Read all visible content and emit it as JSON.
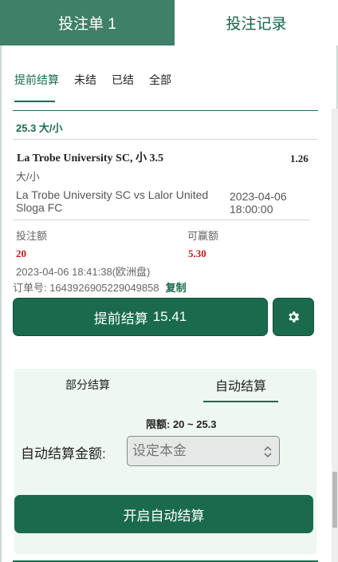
{
  "tabs": {
    "betslip": "投注单 1",
    "records": "投注记录"
  },
  "filters": [
    "提前结算",
    "未结",
    "已结",
    "全部"
  ],
  "bet": {
    "market_title": "25.3 大/小",
    "selection": "La Trobe University SC, 小 3.5",
    "odds": "1.26",
    "market_type": "大/小",
    "match": "La Trobe University SC vs Lalor United Sloga FC",
    "match_date": "2023-04-06",
    "match_time": "18:00:00",
    "stake_label": "投注额",
    "win_label": "可赢额",
    "stake": "20",
    "win": "5.30",
    "placed_time": "2023-04-06 18:41:38(欧洲盘)",
    "order_label": "订单号: 1643926905229049858",
    "copy_label": "复制"
  },
  "cashout": {
    "label": "提前结算",
    "amount": "15.41"
  },
  "auto": {
    "tab_partial": "部分结算",
    "tab_auto": "自动结算",
    "limit": "限额: 20 ~ 25.3",
    "amount_label": "自动结算金额:",
    "placeholder": "设定本金",
    "button": "开启自动结算"
  },
  "icons": {
    "settings": "gear-icon",
    "stepper": "stepper-icon"
  },
  "colors": {
    "primary": "#1a6b4e",
    "tab_active": "#3f8068",
    "accent_red": "#c41a1a",
    "panel_bg": "#eef7f1"
  }
}
